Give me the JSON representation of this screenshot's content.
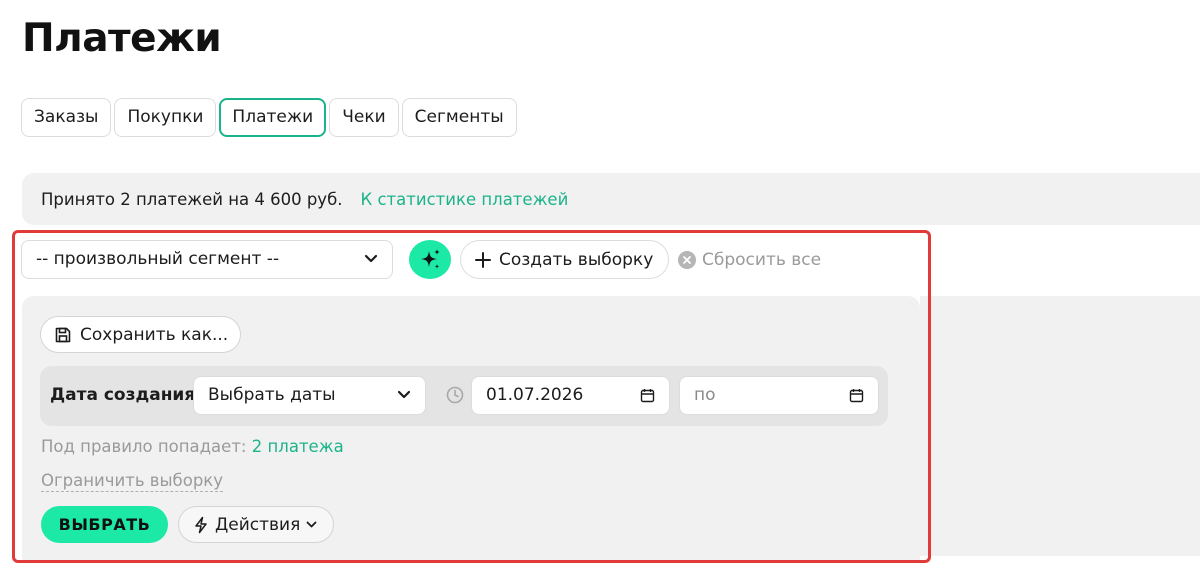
{
  "page": {
    "title": "Платежи"
  },
  "tabs": [
    {
      "label": "Заказы",
      "active": false
    },
    {
      "label": "Покупки",
      "active": false
    },
    {
      "label": "Платежи",
      "active": true
    },
    {
      "label": "Чеки",
      "active": false
    },
    {
      "label": "Сегменты",
      "active": false
    }
  ],
  "stats": {
    "text": "Принято 2 платежей на 4 600 руб.",
    "link": "К статистике платежей"
  },
  "toolbar": {
    "segment_value": "-- произвольный сегмент --",
    "ai_icon": "sparkles-icon",
    "create_label": "Создать выборку",
    "reset_label": "Сбросить все"
  },
  "filter": {
    "save_as_label": "Сохранить как...",
    "rule": {
      "label": "Дата создания",
      "date_select_value": "Выбрать даты",
      "date_from_value": "01.07.2026",
      "date_to_placeholder": "по"
    },
    "rule_count_prefix": "Под правило попадает:",
    "rule_count_link": "2 платежа",
    "limit_label": "Ограничить выборку",
    "select_label": "ВЫБРАТЬ",
    "actions_label": "Действия"
  },
  "colors": {
    "accent": "#1bb48a",
    "accent_button": "#1de9a6",
    "highlight_border": "#e03a3a",
    "panel_bg": "#f1f1f1"
  }
}
